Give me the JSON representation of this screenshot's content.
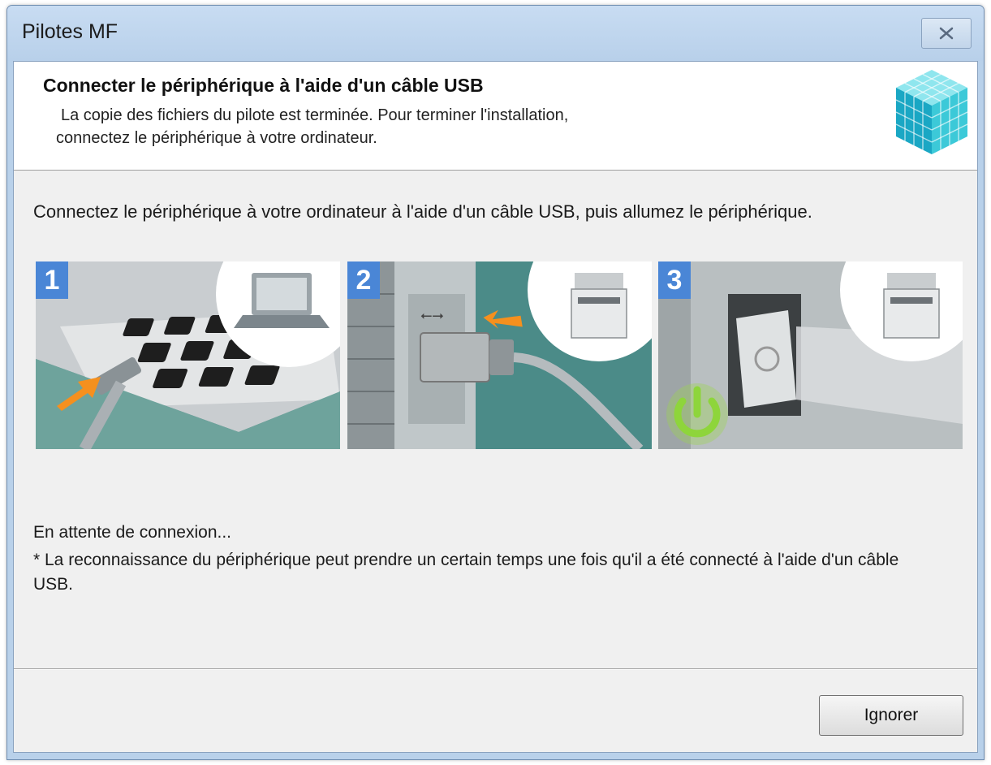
{
  "window": {
    "title": "Pilotes MF",
    "close_icon": "close-icon"
  },
  "header": {
    "title": "Connecter le périphérique à l'aide d'un câble USB",
    "subtitle_line1": "La copie des fichiers du pilote est terminée. Pour terminer l'installation,",
    "subtitle_line2": "connectez le périphérique à votre ordinateur.",
    "logo_icon": "cube-logo-icon"
  },
  "instruction": "Connectez le périphérique à votre ordinateur à l'aide d'un câble USB, puis allumez le périphérique.",
  "steps": [
    {
      "number": "1",
      "icon": "laptop-usb-icon"
    },
    {
      "number": "2",
      "icon": "printer-usb-port-icon"
    },
    {
      "number": "3",
      "icon": "power-switch-icon"
    }
  ],
  "status": "En attente de connexion...",
  "note": "* La reconnaissance du périphérique peut prendre un certain temps une fois qu'il a été connecté à l'aide d'un câble USB.",
  "buttons": {
    "ignore": "Ignorer"
  },
  "colors": {
    "accent": "#4a86d6",
    "titlebar": "#b9d1ea",
    "power_green": "#8ed53b",
    "arrow_orange": "#f5901e"
  }
}
